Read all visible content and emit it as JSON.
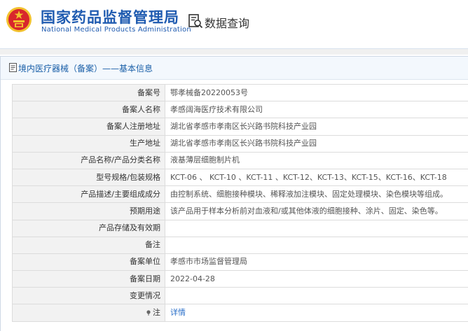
{
  "header": {
    "org_name_cn": "国家药品监督管理局",
    "org_name_en": "National Medical Products Administration",
    "query_label": "数据查询"
  },
  "panel": {
    "title": "境内医疗器械（备案）——基本信息"
  },
  "record": {
    "rows": [
      {
        "label": "备案号",
        "value": "鄂孝械备20220053号"
      },
      {
        "label": "备案人名称",
        "value": "孝感阔海医疗技术有限公司"
      },
      {
        "label": "备案人注册地址",
        "value": "湖北省孝感市孝南区长兴路书院科技产业园"
      },
      {
        "label": "生产地址",
        "value": "湖北省孝感市孝南区长兴路书院科技产业园"
      },
      {
        "label": "产品名称/产品分类名称",
        "value": "液基薄层细胞制片机"
      },
      {
        "label": "型号规格/包装规格",
        "value": "KCT-06 、 KCT-10 、KCT-11 、KCT-12、KCT-13、KCT-15、KCT-16、KCT-18"
      },
      {
        "label": "产品描述/主要组成成分",
        "value": "由控制系统、细胞接种模块、稀释液加注模块、固定处理模块、染色模块等组成。"
      },
      {
        "label": "预期用途",
        "value": "该产品用于样本分析前对血液和/或其他体液的细胞接种、涂片、固定、染色等。"
      },
      {
        "label": "产品存储及有效期",
        "value": ""
      },
      {
        "label": "备注",
        "value": ""
      },
      {
        "label": "备案单位",
        "value": "孝感市市场监督管理局"
      },
      {
        "label": "备案日期",
        "value": "2022-04-28"
      },
      {
        "label": "变更情况",
        "value": ""
      },
      {
        "label": "注",
        "value": "详情"
      }
    ]
  },
  "colors": {
    "brand_blue": "#1f5bb0",
    "emblem_red": "#d8262c",
    "emblem_gold": "#f2c12e",
    "label_bg": "#f2f2f2",
    "link_blue": "#2a6fc9"
  },
  "icons": {
    "emblem": "national-emblem-icon",
    "query": "search-document-icon",
    "panel": "document-icon",
    "note": "pin-icon"
  }
}
